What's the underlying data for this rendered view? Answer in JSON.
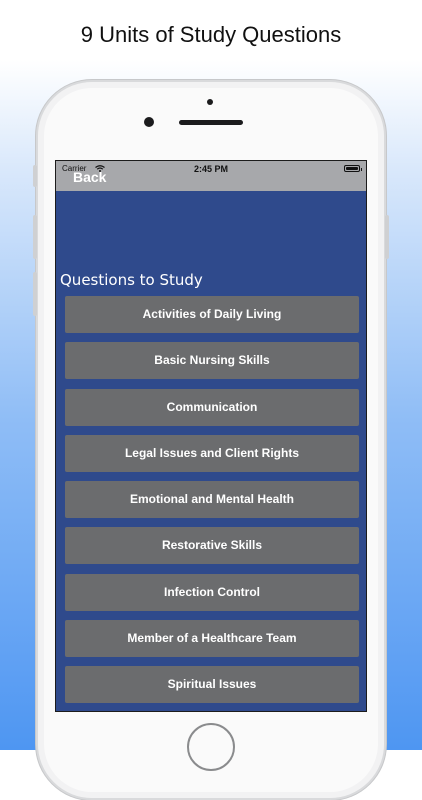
{
  "headline": "9 Units of Study Questions",
  "status_bar": {
    "carrier": "Carrier",
    "time": "2:45 PM"
  },
  "nav": {
    "back_label": "Back"
  },
  "section_title": "Questions to Study",
  "topics": [
    {
      "label": "Activities of Daily Living"
    },
    {
      "label": "Basic Nursing Skills"
    },
    {
      "label": "Communication"
    },
    {
      "label": "Legal Issues and Client Rights"
    },
    {
      "label": "Emotional and Mental Health"
    },
    {
      "label": "Restorative Skills"
    },
    {
      "label": "Infection Control"
    },
    {
      "label": "Member of a Healthcare Team"
    },
    {
      "label": "Spiritual Issues"
    }
  ],
  "colors": {
    "screen_background": "#2f4a8c",
    "nav_bar": "#a7a8ab",
    "topic_button": "#6b6c6e",
    "page_gradient_bottom": "#4e96f2"
  },
  "icons": [
    "wifi-icon",
    "battery-icon"
  ]
}
